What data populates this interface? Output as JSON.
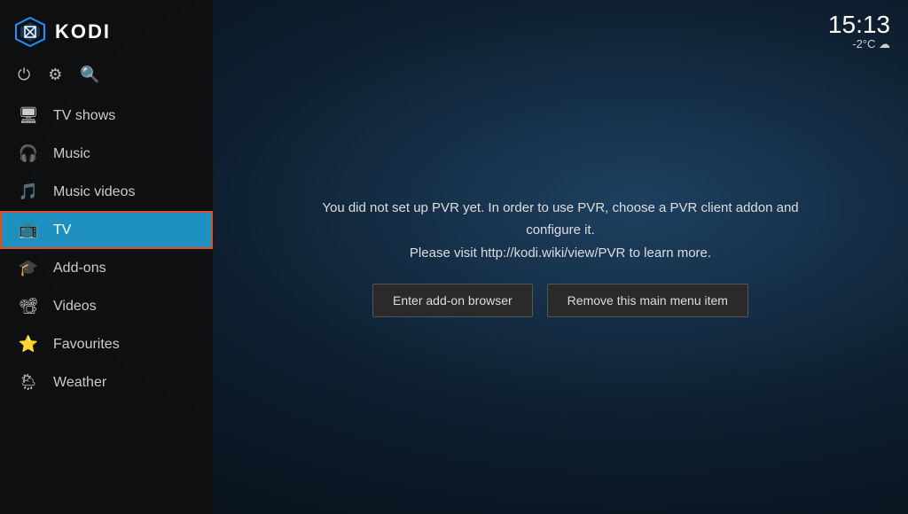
{
  "app": {
    "title": "KODI"
  },
  "clock": {
    "time": "15:13",
    "weather": "-2°C ☁"
  },
  "toolbar": {
    "power_icon": "⏻",
    "settings_icon": "⚙",
    "search_icon": "🔍"
  },
  "sidebar": {
    "items": [
      {
        "id": "tv-shows",
        "label": "TV shows",
        "icon": "🖥",
        "active": false
      },
      {
        "id": "music",
        "label": "Music",
        "icon": "🎧",
        "active": false
      },
      {
        "id": "music-videos",
        "label": "Music videos",
        "icon": "🎵",
        "active": false
      },
      {
        "id": "tv",
        "label": "TV",
        "icon": "📺",
        "active": true
      },
      {
        "id": "add-ons",
        "label": "Add-ons",
        "icon": "🎓",
        "active": false
      },
      {
        "id": "videos",
        "label": "Videos",
        "icon": "📽",
        "active": false
      },
      {
        "id": "favourites",
        "label": "Favourites",
        "icon": "⭐",
        "active": false
      },
      {
        "id": "weather",
        "label": "Weather",
        "icon": "🌦",
        "active": false
      }
    ]
  },
  "main": {
    "pvr_message_line1": "You did not set up PVR yet. In order to use PVR, choose a PVR client addon and configure it.",
    "pvr_message_line2": "Please visit http://kodi.wiki/view/PVR to learn more.",
    "btn_addon_browser": "Enter add-on browser",
    "btn_remove_menu": "Remove this main menu item"
  }
}
